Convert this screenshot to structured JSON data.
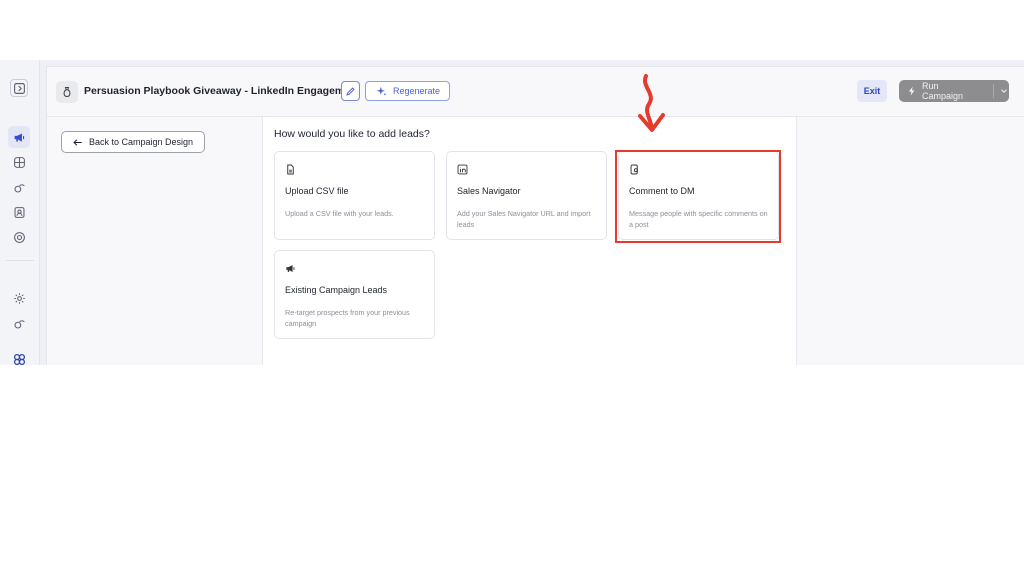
{
  "header": {
    "title": "Persuasion Playbook Giveaway - LinkedIn Engagement",
    "regenerate_label": "Regenerate",
    "exit_label": "Exit",
    "run_label": "Run Campaign"
  },
  "left": {
    "back_label": "Back to Campaign Design"
  },
  "main": {
    "question": "How would you like to add leads?",
    "options": [
      {
        "icon": "file-csv-icon",
        "title": "Upload CSV file",
        "description": "Upload a CSV file with your leads."
      },
      {
        "icon": "linkedin-icon",
        "title": "Sales Navigator",
        "description": "Add your Sales Navigator URL and import leads"
      },
      {
        "icon": "comment-dm-icon",
        "title": "Comment to DM",
        "description": "Message people with specific comments on a post"
      },
      {
        "icon": "megaphone-icon",
        "title": "Existing Campaign Leads",
        "description": "Re-target prospects from your previous campaign"
      }
    ]
  },
  "annotation": {
    "highlight_color": "#e53b2c",
    "highlighted_option": "Comment to DM"
  },
  "colors": {
    "accent": "#4a62d8",
    "run_button": "#8d8d8f"
  }
}
